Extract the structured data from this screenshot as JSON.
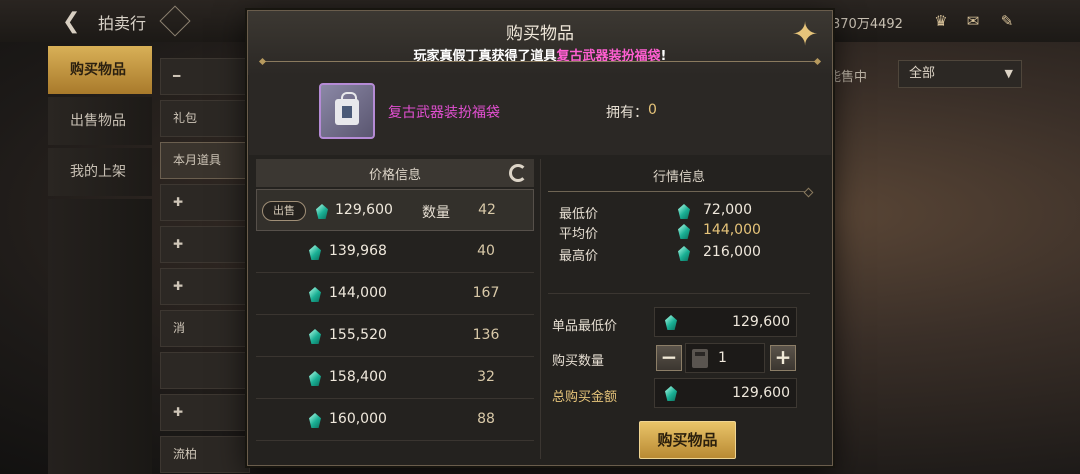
{
  "top": {
    "title": "拍卖行",
    "currency_text": "370万4492"
  },
  "left_nav": [
    {
      "label": "购买物品",
      "active": true
    },
    {
      "label": "出售物品",
      "active": false
    },
    {
      "label": "我的上架",
      "active": false
    }
  ],
  "categories": {
    "row1": "礼包",
    "row2": "本月道具",
    "row3": "消",
    "row4": "流柏"
  },
  "right_filter": {
    "label": "能售中",
    "select_value": "全部"
  },
  "modal": {
    "title": "购买物品",
    "notice_prefix": "玩家真假丁真获得了道具",
    "notice_item": "复古武器装扮福袋",
    "notice_suffix": "!",
    "item_name": "复古武器装扮福袋",
    "own_label": "拥有：",
    "own_value": "0",
    "price_info_title": "价格信息",
    "sell_tag": "出售",
    "qty_label": "数量",
    "listings": [
      {
        "price": "129,600",
        "qty": "42"
      },
      {
        "price": "139,968",
        "qty": "40"
      },
      {
        "price": "144,000",
        "qty": "167"
      },
      {
        "price": "155,520",
        "qty": "136"
      },
      {
        "price": "158,400",
        "qty": "32"
      },
      {
        "price": "160,000",
        "qty": "88"
      }
    ],
    "market_title": "行情信息",
    "min_label": "最低价",
    "min_value": "72,000",
    "avg_label": "平均价",
    "avg_value": "144,000",
    "max_label": "最高价",
    "max_value": "216,000",
    "unit_min_label": "单品最低价",
    "unit_min_value": "129,600",
    "buy_qty_label": "购买数量",
    "buy_qty_value": "1",
    "total_label": "总购买金额",
    "total_value": "129,600",
    "buy_button": "购买物品"
  },
  "colors": {
    "accent_gold": "#e6c47a",
    "item_name_pink": "#e14fd1",
    "gem_teal": "#1ab095"
  }
}
